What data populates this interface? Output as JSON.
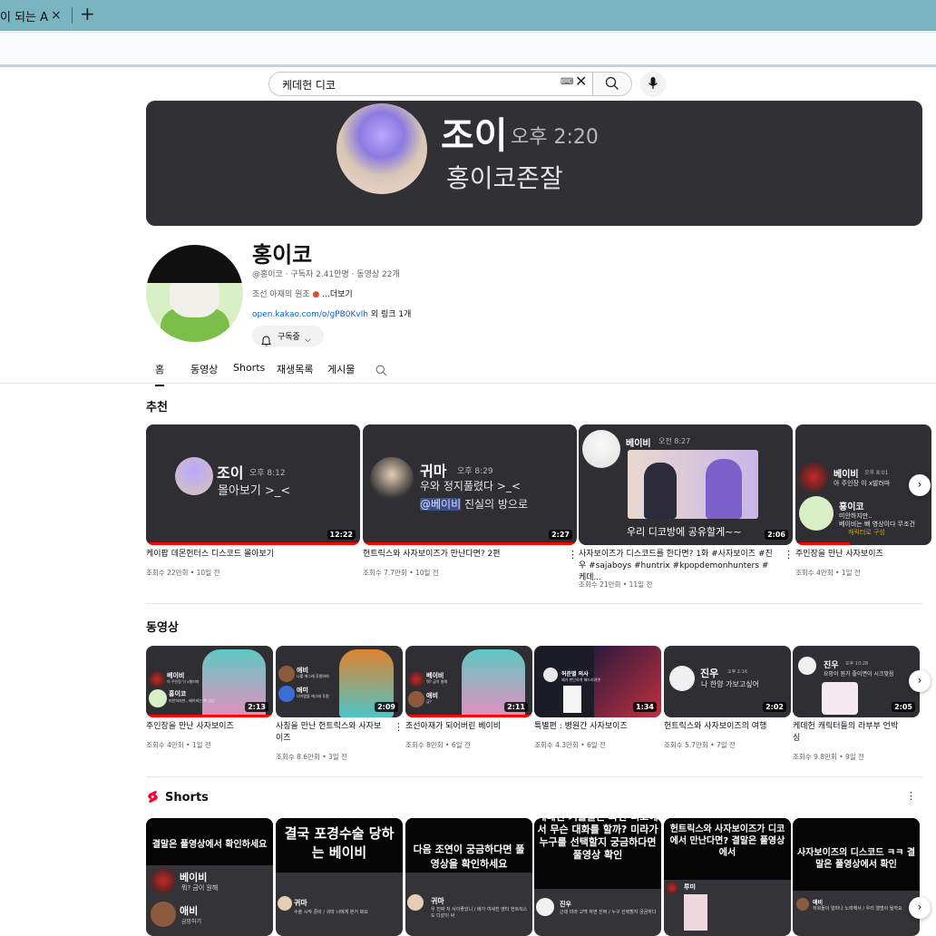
{
  "browser": {
    "tab_title": "이 되는 A",
    "close_glyph": "×",
    "newtab_glyph": "+"
  },
  "search": {
    "query": "케데헌 디코",
    "keyboard_glyph": "⌨",
    "clear_glyph": "✕"
  },
  "banner": {
    "name": "조이",
    "time": "오후 2:20",
    "message": "홍이코존잘"
  },
  "channel": {
    "name": "홍이코",
    "meta": "@홍이코 · 구독자 2.41만명 · 동영상 22개",
    "desc_prefix": "조선 아재의 원조 ",
    "desc_more": "...더보기",
    "link": "open.kakao.com/o/gPB0Kvlh",
    "link_more": " 외 링크 1개",
    "subscribe_label": "구독중",
    "bell_glyph": "🔔",
    "chevron_glyph": "⌵"
  },
  "tabs": {
    "home": "홈",
    "videos": "동영상",
    "shorts": "Shorts",
    "playlists": "재생목록",
    "posts": "게시물"
  },
  "recommended": {
    "title": "추천",
    "items": [
      {
        "title": "케이팝 데몬헌터스 디스코드 몰아보기",
        "meta": "조회수 22만회 • 10일 전",
        "duration": "12:22",
        "t_name": "조이",
        "t_time": "오후 8:12",
        "t_msg": "몰아보기 >_<"
      },
      {
        "title": "헌트릭스와 사자보이즈가 만난다면? 2편",
        "meta": "조회수 7.7만회 • 10일 전",
        "duration": "2:27",
        "t_name": "귀마",
        "t_time": "오후 8:29",
        "t_msg1": "우와 정지풀렸다 >_<",
        "t_mention": "@베이비",
        "t_msg2": " 진실의 방으로"
      },
      {
        "title": "사자보이즈가 디스코드를 한다면? 1화 #사자보이즈 #진우 #sajaboys #huntrix #kpopdemonhunters #케데...",
        "meta": "조회수 21만회 • 11일 전",
        "duration": "2:06",
        "t_name": "베이비",
        "t_time": "오전 8:27",
        "t_msg": "우리 디코방에 공유할게~~"
      },
      {
        "title": "주인장을 만난 사자보이즈",
        "meta": "조회수 4만회 • 1일 전",
        "duration": "",
        "t_name": "베이비",
        "t_time": "오후 8:01",
        "t_msg": "아 주인장 이 x발러마",
        "t_name2": "홍이코",
        "t_msg2": "미안하지만..",
        "t_msg3": "베이비는 뼈 영상이다 무조건",
        "t_msg4": "캐릭터로 구성"
      }
    ]
  },
  "videos": {
    "title": "동영상",
    "items": [
      {
        "title": "주인장을 만난 사자보이즈",
        "meta": "조회수 4만회 • 1일 전",
        "duration": "2:13"
      },
      {
        "title": "사칭을 만난 헌트릭스와 사자보이즈",
        "meta": "조회수 8.6만회 • 3일 전",
        "duration": "2:09"
      },
      {
        "title": "조선아재가 되어버린 베이비",
        "meta": "조회수 8만회 • 6일 전",
        "duration": "2:11"
      },
      {
        "title": "특별편 : 병원간 사자보이즈",
        "meta": "조회수 4.3만회 • 6일 전",
        "duration": "1:34"
      },
      {
        "title": "헌트릭스와 사자보이즈의 여행",
        "meta": "조회수 5.7만회 • 7일 전",
        "duration": "2:02",
        "t_name": "진우",
        "t_time": "오후 2:16",
        "t_msg": "나 한양 가보고싶어"
      },
      {
        "title": "케데헌 캐릭터들의 라부부 언박싱",
        "meta": "조회수 9.8만회 • 9일 전",
        "duration": "2:05",
        "t_name": "진우",
        "t_time": "오후 10:28",
        "t_msg": "요망이 뭔가 좋이면이 시크맞음"
      }
    ],
    "mini": {
      "v1": {
        "n1": "베이비",
        "n2": "홍이코",
        "m1": "이 주인장 이 x발러마",
        "m2": "미안하지만.. 베이비는 뼈 영상"
      },
      "v2": {
        "n1": "애비",
        "n2": "애미",
        "m1": "나를 애그래 후원하여",
        "m2": "너어렸을 애그래 후원"
      },
      "v3": {
        "n1": "베이비",
        "n2": "애비",
        "m1": "뭐? 금이 원해",
        "m2": "금?"
      },
      "v4": {
        "n1": "허준별 의사",
        "m1": "제가 판단하게 해드리려면"
      }
    }
  },
  "shorts": {
    "title": "Shorts",
    "items": [
      {
        "head": "결말은 풀영상에서 확인하세요",
        "n1": "베이비",
        "m1": "뭐? 금이 원해",
        "n2": "애비",
        "m2": "금망하기"
      },
      {
        "head": "결국 포경수술 당하는 베이비",
        "n1": "귀마",
        "m1": "수술 시작 준비 / 귀마 너에게 본거 봐요"
      },
      {
        "head": "다음 조연이 궁금하다면 풀영상을 확인하세요",
        "n1": "귀마",
        "m1": "우 진짜 저 사이좋았니 / 베가 여세진 영타 헌트릭스도 다같이 싸"
      },
      {
        "head": "케데헌 커플들은 과연 디코에서 무슨 대화를 할까? 미라가 누구를 선택할지 궁금하다면 풀영상 확인",
        "n1": "진우",
        "m1": "근데 미라 고백 하면 진짜 / 누구 선택할지 궁금하다"
      },
      {
        "head": "헌트릭스와 사자보이즈가 디코에서 만난다면? 결말은 풀영상에서",
        "n1": "루미",
        "m1": ""
      },
      {
        "head": "사자보이즈의 디스코드 ㅋㅋ 결말은 풀영상에서 확인",
        "n1": "애비",
        "m1": "저희들이 얼마나 노력해서 / 우리 앨범이 될까요"
      }
    ]
  },
  "icons": {
    "search": "search-icon",
    "mic": "microphone-icon",
    "kebab_glyph": "⋮",
    "next_glyph": "›"
  },
  "colors": {
    "tabbar": "#7ab4c0",
    "thumb_bg": "#2f2f33",
    "progress": "#ff0000",
    "shorts_red": "#ff0033",
    "link": "#065fd4"
  }
}
